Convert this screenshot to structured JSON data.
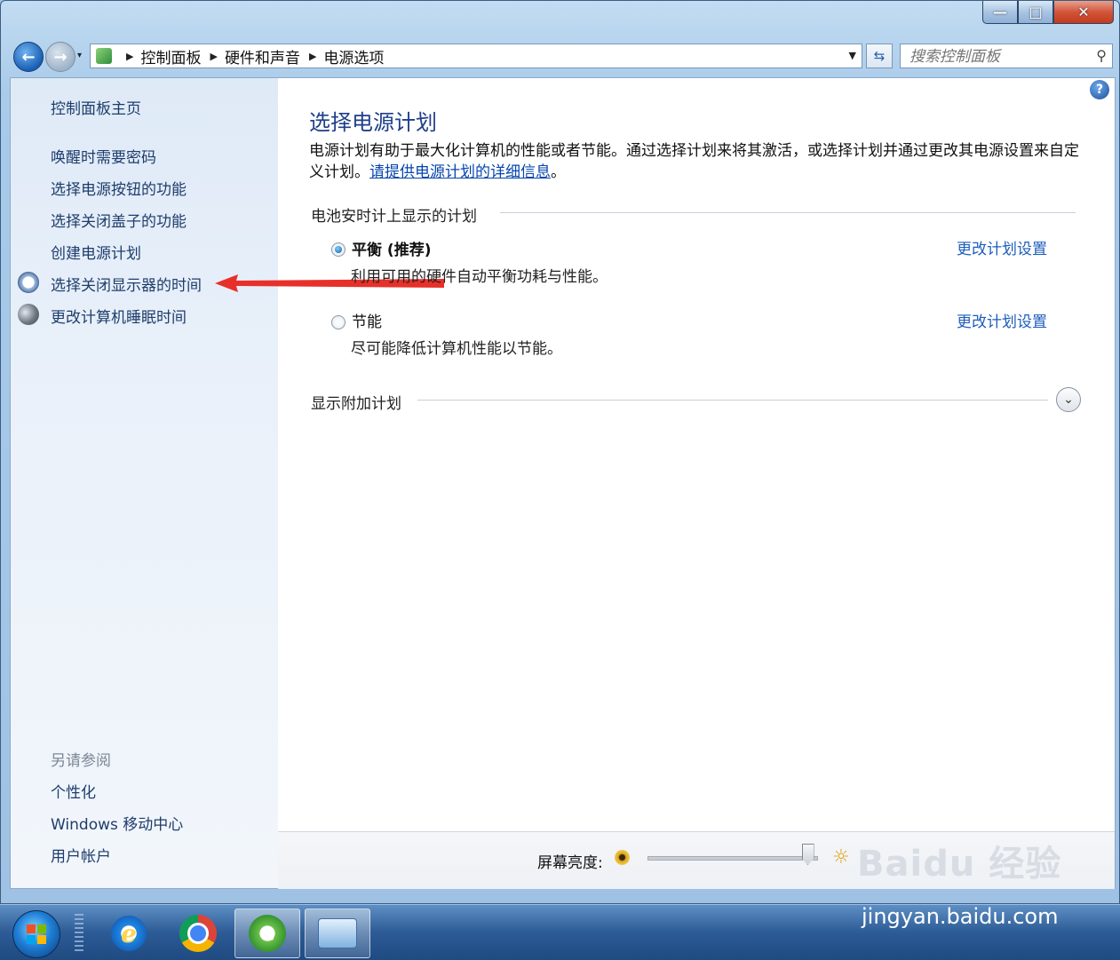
{
  "breadcrumb": [
    "控制面板",
    "硬件和声音",
    "电源选项"
  ],
  "search": {
    "placeholder": "搜索控制面板"
  },
  "sidebar": {
    "home": "控制面板主页",
    "links": [
      "唤醒时需要密码",
      "选择电源按钮的功能",
      "选择关闭盖子的功能",
      "创建电源计划",
      "选择关闭显示器的时间",
      "更改计算机睡眠时间"
    ],
    "see_also_title": "另请参阅",
    "see_also": [
      "个性化",
      "Windows 移动中心",
      "用户帐户"
    ]
  },
  "main": {
    "title": "选择电源计划",
    "description": "电源计划有助于最大化计算机的性能或者节能。通过选择计划来将其激活，或选择计划并通过更改其电源设置来自定义计划。",
    "description_link": "请提供电源计划的详细信息",
    "description_end": "。",
    "section_battery": "电池安时计上显示的计划",
    "plans": [
      {
        "name": "平衡 (推荐)",
        "desc": "利用可用的硬件自动平衡功耗与性能。",
        "link": "更改计划设置",
        "selected": true
      },
      {
        "name": "节能",
        "desc": "尽可能降低计算机性能以节能。",
        "link": "更改计划设置",
        "selected": false
      }
    ],
    "section_more": "显示附加计划",
    "brightness_label": "屏幕亮度:",
    "brightness_level": 0.95
  },
  "colors": {
    "accent_link": "#1e5dbb",
    "title": "#1f3f8a",
    "annotation_arrow": "#e8302a"
  },
  "icons": [
    "back-icon",
    "forward-icon",
    "refresh-icon",
    "search-icon",
    "help-icon",
    "clock-icon",
    "moon-icon",
    "expand-chevron-icon"
  ],
  "watermark": {
    "logo": "Baidu 经验",
    "url": "jingyan.baidu.com"
  }
}
